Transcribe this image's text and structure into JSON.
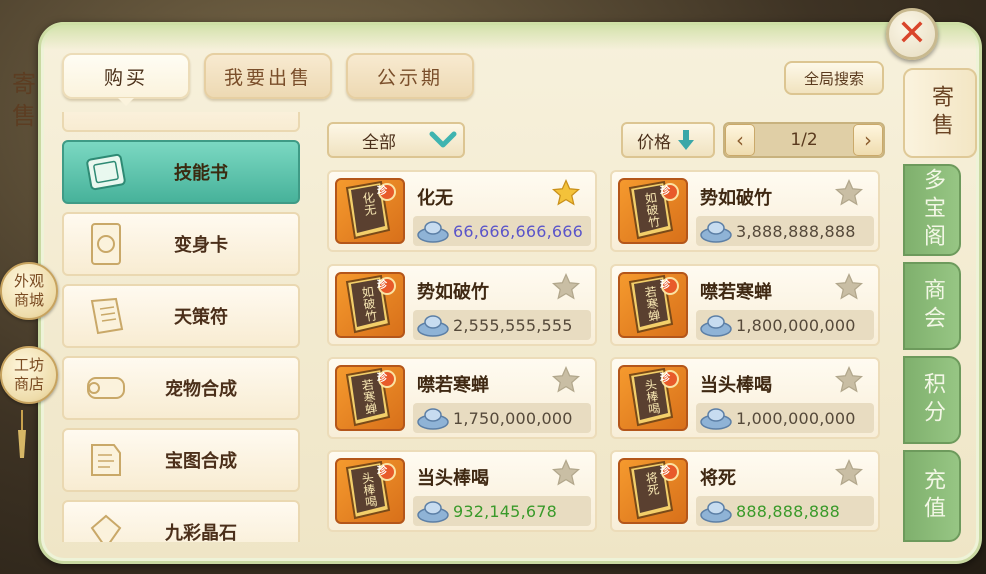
{
  "side_title": "寄售",
  "left_buttons": [
    {
      "label": "外观商城"
    },
    {
      "label": "工坊商店"
    }
  ],
  "top_tabs": [
    {
      "label": "购买",
      "active": true
    },
    {
      "label": "我要出售",
      "active": false
    },
    {
      "label": "公示期",
      "active": false
    }
  ],
  "search_label": "全局搜索",
  "close_icon": "close-icon",
  "right_tabs": [
    {
      "label": "寄售",
      "active": true
    },
    {
      "label": "多宝阁",
      "active": false
    },
    {
      "label": "商会",
      "active": false
    },
    {
      "label": "积分",
      "active": false
    },
    {
      "label": "充值",
      "active": false
    }
  ],
  "categories": [
    {
      "label": "技能书",
      "icon": "skill-book-icon",
      "active": true
    },
    {
      "label": "变身卡",
      "icon": "transform-card-icon",
      "active": false
    },
    {
      "label": "天策符",
      "icon": "talisman-icon",
      "active": false
    },
    {
      "label": "宠物合成",
      "icon": "pet-scroll-icon",
      "active": false
    },
    {
      "label": "宝图合成",
      "icon": "treasure-map-icon",
      "active": false
    },
    {
      "label": "九彩晶石",
      "icon": "crystal-icon",
      "active": false
    }
  ],
  "filter": {
    "selected": "全部"
  },
  "sort": {
    "label": "价格",
    "direction": "down"
  },
  "pager": {
    "text": "1/2",
    "prev": "‹",
    "next": "›"
  },
  "colors": {
    "price_purple": "#5b55c9",
    "price_gray": "#55493a",
    "price_green": "#3a9a2a",
    "accent_green": "#47b29a"
  },
  "items": [
    {
      "name": "化无",
      "book_text": "化无",
      "price": "66,666,666,666",
      "price_color": "purple",
      "starred": true,
      "badge": "珍"
    },
    {
      "name": "势如破竹",
      "book_text": "如破竹",
      "price": "3,888,888,888",
      "price_color": "gray",
      "starred": false,
      "badge": "珍"
    },
    {
      "name": "势如破竹",
      "book_text": "如破竹",
      "price": "2,555,555,555",
      "price_color": "gray",
      "starred": false,
      "badge": "珍"
    },
    {
      "name": "噤若寒蝉",
      "book_text": "若寒蝉",
      "price": "1,800,000,000",
      "price_color": "gray",
      "starred": false,
      "badge": "珍"
    },
    {
      "name": "噤若寒蝉",
      "book_text": "若寒蝉",
      "price": "1,750,000,000",
      "price_color": "gray",
      "starred": false,
      "badge": "珍"
    },
    {
      "name": "当头棒喝",
      "book_text": "头棒喝",
      "price": "1,000,000,000",
      "price_color": "gray",
      "starred": false,
      "badge": "珍"
    },
    {
      "name": "当头棒喝",
      "book_text": "头棒喝",
      "price": "932,145,678",
      "price_color": "green",
      "starred": false,
      "badge": "珍"
    },
    {
      "name": "将死",
      "book_text": "将死",
      "price": "888,888,888",
      "price_color": "green",
      "starred": false,
      "badge": "珍"
    }
  ]
}
